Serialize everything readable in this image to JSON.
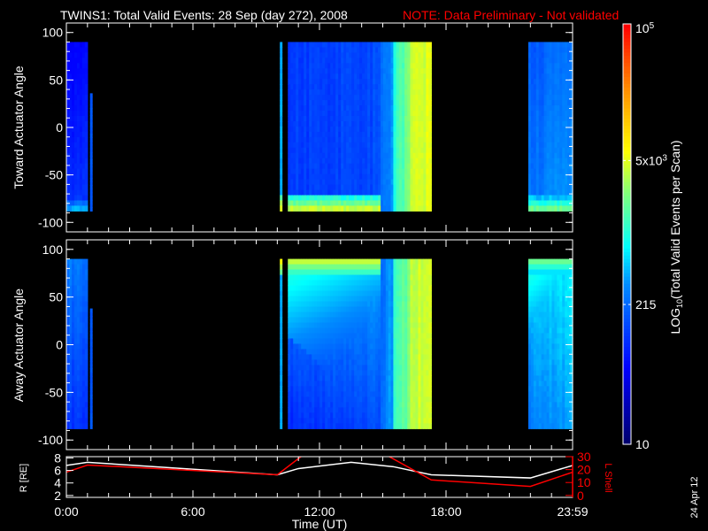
{
  "title": "TWINS1: Total Valid Events: 28 Sep (day 272), 2008",
  "note": "NOTE: Data Preliminary - Not validated",
  "date_stamp": "24 Apr 12",
  "colors": {
    "line_r": "#ffffff",
    "line_l": "#ff0000",
    "frame": "#ffffff"
  },
  "chart_data": [
    {
      "type": "heatmap",
      "title": "Toward Actuator Angle",
      "ylabel": "Toward Actuator Angle",
      "ylim": [
        -110,
        110
      ],
      "yticks": [
        "100",
        "50",
        "0",
        "-50",
        "-100"
      ],
      "ytick_values": [
        100,
        50,
        0,
        -50,
        -100
      ],
      "xlim_hours": [
        0,
        24
      ],
      "value_units": "log10 counts",
      "blocks": [
        {
          "t": [
            0,
            1.0
          ],
          "a": [
            -88,
            90
          ],
          "v0": 2.0,
          "v_t": 0.0,
          "v_a": -0.3,
          "bottom_band": 2.6
        },
        {
          "t": [
            1.12,
            1.22
          ],
          "a": [
            -88,
            36
          ],
          "v0": 2.2,
          "v_t": 0,
          "v_a": 0
        },
        {
          "t": [
            10.12,
            10.22
          ],
          "a": [
            -88,
            90
          ],
          "v0": 2.6,
          "v_t": 0,
          "v_a": 0,
          "bottom_band": 3.8
        },
        {
          "t": [
            10.5,
            14.9
          ],
          "a": [
            -88,
            90
          ],
          "v0": 2.05,
          "v_t": 0.1,
          "v_a": 0.0,
          "bottom_band": 3.6
        },
        {
          "t": [
            14.9,
            15.5
          ],
          "a": [
            -88,
            90
          ],
          "v0": 2.3,
          "v_t": 0.3,
          "v_a": 0
        },
        {
          "t": [
            15.5,
            16.3
          ],
          "a": [
            -88,
            90
          ],
          "v0": 3.0,
          "v_t": 0.4,
          "v_a": 0
        },
        {
          "t": [
            16.3,
            17.3
          ],
          "a": [
            -88,
            90
          ],
          "v0": 3.6,
          "v_t": 0.1,
          "v_a": 0
        },
        {
          "t": [
            21.9,
            24.0
          ],
          "a": [
            -88,
            90
          ],
          "v0": 2.4,
          "v_t": 0.2,
          "v_a": -0.2,
          "bottom_band": 3.3
        }
      ]
    },
    {
      "type": "heatmap",
      "title": "Away Actuator Angle",
      "ylabel": "Away Actuator Angle",
      "ylim": [
        -110,
        110
      ],
      "yticks": [
        "100",
        "50",
        "0",
        "-50",
        "-100"
      ],
      "ytick_values": [
        100,
        50,
        0,
        -50,
        -100
      ],
      "xlim_hours": [
        0,
        24
      ],
      "value_units": "log10 counts",
      "blocks": [
        {
          "t": [
            0,
            1.0
          ],
          "a": [
            -88,
            90
          ],
          "v0": 2.0,
          "v_t": 0.0,
          "v_a": 0.4
        },
        {
          "t": [
            1.12,
            1.22
          ],
          "a": [
            -88,
            38
          ],
          "v0": 2.2,
          "v_t": 0,
          "v_a": 0
        },
        {
          "t": [
            10.12,
            10.22
          ],
          "a": [
            -88,
            90
          ],
          "v0": 2.6,
          "v_t": 0,
          "v_a": 0,
          "top_band": 3.8
        },
        {
          "t": [
            10.5,
            14.9
          ],
          "a": [
            -88,
            90
          ],
          "v0": 1.95,
          "v_t": 0.2,
          "v_a": 0.5,
          "top_band": 3.6
        },
        {
          "t": [
            14.9,
            15.5
          ],
          "a": [
            -88,
            90
          ],
          "v0": 2.3,
          "v_t": 0.3,
          "v_a": 0
        },
        {
          "t": [
            15.5,
            16.3
          ],
          "a": [
            -88,
            90
          ],
          "v0": 3.0,
          "v_t": 0.4,
          "v_a": 0
        },
        {
          "t": [
            16.3,
            17.3
          ],
          "a": [
            -88,
            90
          ],
          "v0": 3.6,
          "v_t": 0.1,
          "v_a": 0
        },
        {
          "t": [
            21.9,
            24.0
          ],
          "a": [
            -88,
            90
          ],
          "v0": 2.4,
          "v_t": 0.2,
          "v_a": 0.3,
          "top_band": 3.3
        }
      ]
    },
    {
      "type": "line",
      "ylabel": "R [RE]",
      "ylabel_right": "L Shell",
      "ylim": [
        2,
        8
      ],
      "yticks": [
        "8",
        "6",
        "4",
        "2"
      ],
      "ytick_values": [
        8,
        6,
        4,
        2
      ],
      "ylim_right": [
        0,
        30
      ],
      "yticks_right": [
        "30",
        "20",
        "10",
        "0"
      ],
      "ytick_values_right": [
        30,
        20,
        10,
        0
      ],
      "xlabel": "Time (UT)",
      "xticks": [
        "0:00",
        "6:00",
        "12:00",
        "18:00",
        "23:59"
      ],
      "xtick_hours": [
        0,
        6,
        12,
        18,
        24
      ],
      "series": [
        {
          "name": "R",
          "axis": "left",
          "x": [
            0,
            1,
            10,
            11,
            13.5,
            15.5,
            17.3,
            22,
            24
          ],
          "y": [
            6.8,
            7.3,
            5.3,
            6.3,
            7.3,
            6.6,
            5.3,
            4.8,
            6.8
          ]
        },
        {
          "name": "L Shell",
          "axis": "right",
          "x": [
            0,
            1,
            10,
            11.2,
            15.2,
            17.3,
            22,
            24
          ],
          "y": [
            18,
            23.5,
            16,
            31,
            31,
            12,
            7,
            18
          ]
        }
      ]
    },
    {
      "type": "colorbar",
      "label": "LOG10(Total Valid Events per Scan)",
      "label_main": "LOG",
      "label_sub": "10",
      "label_rest": "(Total Valid Events per Scan)",
      "range_log10": [
        1,
        5
      ],
      "ticks": [
        {
          "label": "10",
          "log10": 1
        },
        {
          "label": "215",
          "log10": 2.33
        },
        {
          "label": "5x10",
          "sup": "3",
          "log10": 3.7
        },
        {
          "label": "10",
          "sup": "5",
          "log10": 5
        }
      ]
    }
  ]
}
